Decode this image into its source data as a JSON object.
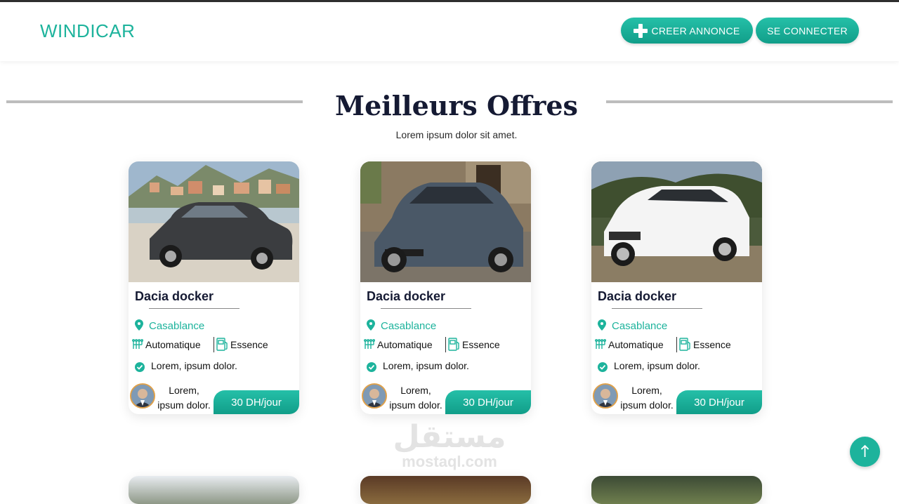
{
  "header": {
    "brand": "WINDICAR",
    "create_label": "CREER ANNONCE",
    "login_label": "SE CONNECTER"
  },
  "section": {
    "title": "Meilleurs Offres",
    "subtitle": "Lorem ipsum dolor sit amet."
  },
  "cards": [
    {
      "name": "Dacia docker",
      "city": "Casablance",
      "transmission": "Automatique",
      "fuel": "Essence",
      "feature": "Lorem, ipsum dolor.",
      "owner": "Lorem, ipsum dolor.",
      "price": "30 DH/jour",
      "car_color": "#3b3d40"
    },
    {
      "name": "Dacia docker",
      "city": "Casablance",
      "transmission": "Automatique",
      "fuel": "Essence",
      "feature": "Lorem, ipsum dolor.",
      "owner": "Lorem, ipsum dolor.",
      "price": "30 DH/jour",
      "car_color": "#4a5867"
    },
    {
      "name": "Dacia docker",
      "city": "Casablance",
      "transmission": "Automatique",
      "fuel": "Essence",
      "feature": "Lorem, ipsum dolor.",
      "owner": "Lorem, ipsum dolor.",
      "price": "30 DH/jour",
      "car_color": "#f4f4f4"
    }
  ],
  "watermark": {
    "arabic": "مستقل",
    "latin": "mostaql.com"
  },
  "colors": {
    "accent": "#1db39c",
    "title": "#151a33",
    "rule": "#bdbdbd"
  },
  "icons": [
    "plus-icon",
    "map-pin-icon",
    "gearbox-icon",
    "fuel-pump-icon",
    "check-circle-icon",
    "arrow-up-icon"
  ]
}
